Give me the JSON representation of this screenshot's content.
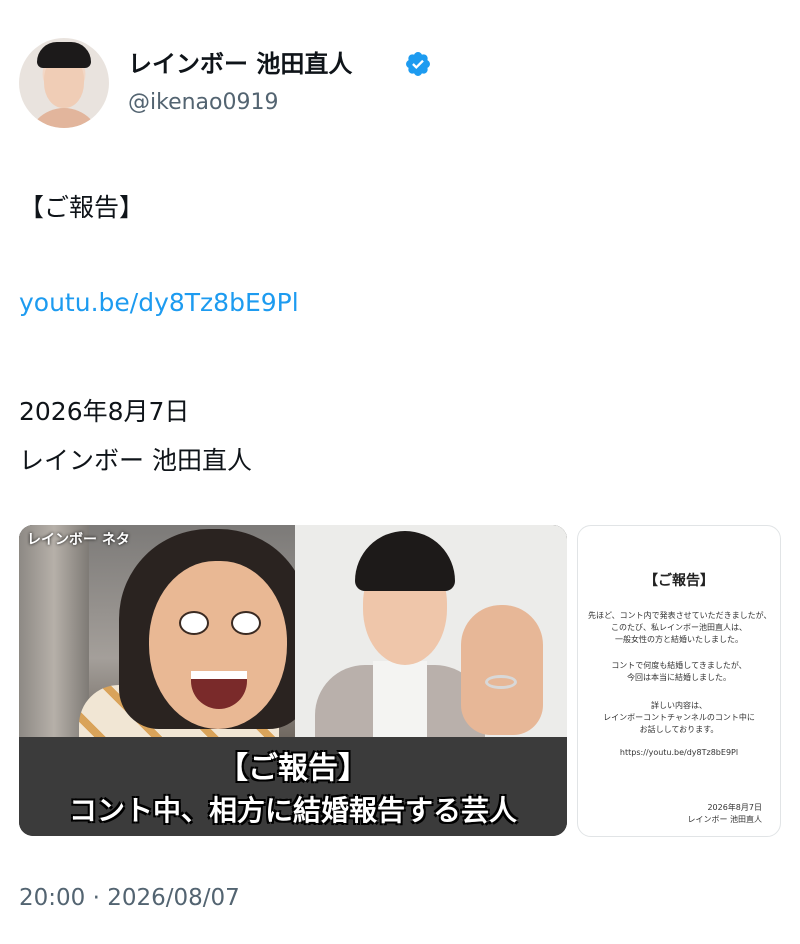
{
  "author": {
    "display_name": "レインボー 池田直人",
    "handle": "@ikenao0919",
    "verified": true,
    "verified_color": "#1d9bf0"
  },
  "tweet": {
    "lines": [
      "【ご報告】",
      "youtu.be/dy8Tz8bE9Pl",
      "2026年8月7日",
      "レインボー 池田直人"
    ],
    "link_color": "#1d9bf0"
  },
  "media": {
    "video": {
      "corner_tag": "レインボー ネタ",
      "caption_line1": "【ご報告】",
      "caption_line2": "コント中、相方に結婚報告する芸人"
    },
    "document": {
      "title": "【ご報告】",
      "paragraphs": [
        "先ほど、コント内で発表させていただきましたが、",
        "このたび、私レインボー池田直人は、",
        "一般女性の方と結婚いたしました。",
        "コントで何度も結婚してきましたが、",
        "今回は本当に結婚しました。",
        "詳しい内容は、",
        "レインボーコントチャンネルのコント中に",
        "お話ししております。",
        "https://youtu.be/dy8Tz8bE9Pl"
      ],
      "signature_date": "2026年8月7日",
      "signature_name": "レインボー 池田直人"
    }
  },
  "meta": {
    "timestamp": "20:00 · 2026/08/07"
  }
}
